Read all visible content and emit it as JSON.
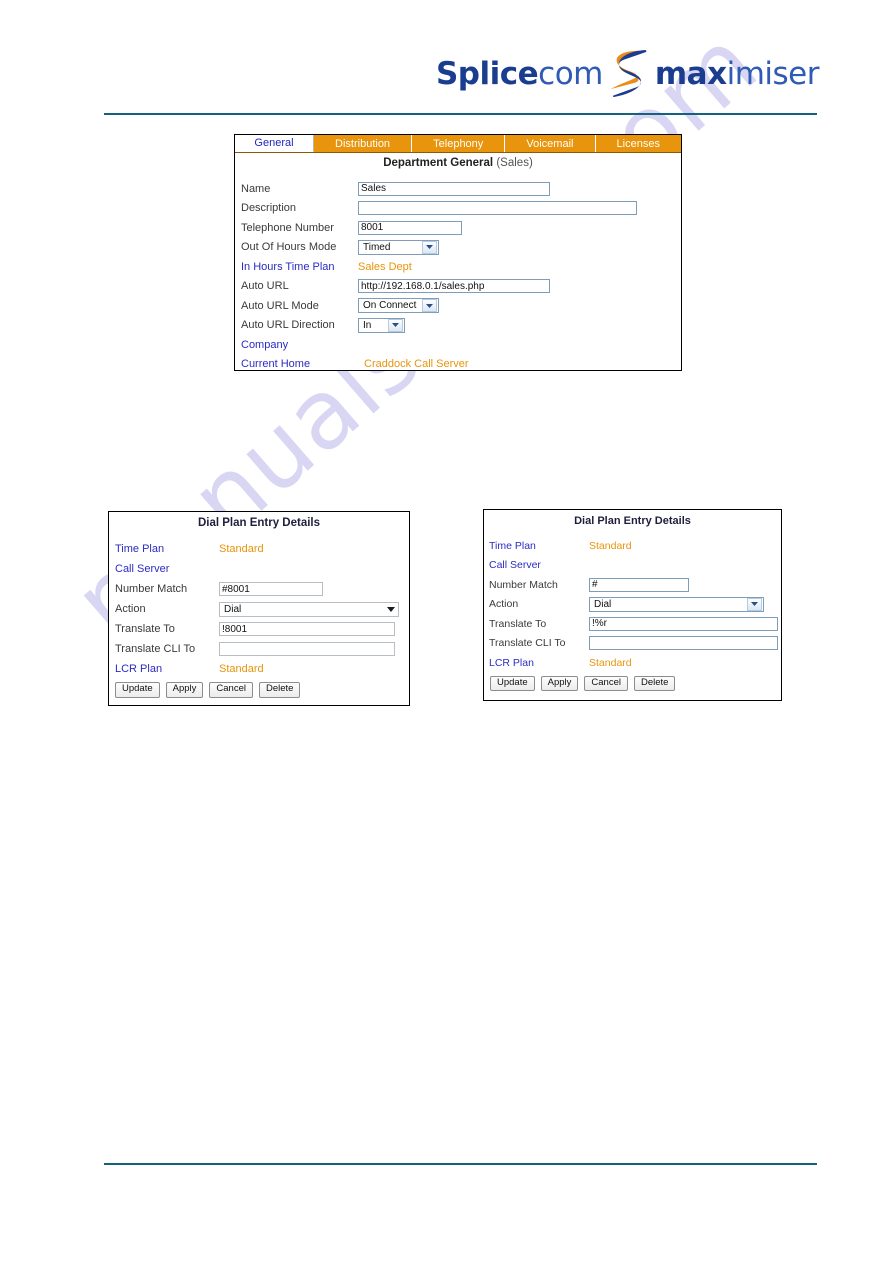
{
  "brand": {
    "name_part1": "Splice",
    "name_part2": "com",
    "name_part3": "max",
    "name_part4": "imiser",
    "swoosh_icon": "s-swoosh-icon",
    "color_dark_blue": "#1b3d8f",
    "color_light_blue": "#2f5ab5",
    "color_orange": "#e8940c"
  },
  "watermark": {
    "text": "manualshive.com"
  },
  "department_panel": {
    "tabs": [
      {
        "label": "General",
        "active": true
      },
      {
        "label": "Distribution",
        "active": false
      },
      {
        "label": "Telephony",
        "active": false
      },
      {
        "label": "Voicemail",
        "active": false
      },
      {
        "label": "Licenses",
        "active": false
      }
    ],
    "title_main": "Department General",
    "title_sub": "(Sales)",
    "fields": {
      "name_label": "Name",
      "name_value": "Sales",
      "description_label": "Description",
      "description_value": "",
      "telephone_number_label": "Telephone Number",
      "telephone_number_value": "8001",
      "out_of_hours_mode_label": "Out Of Hours Mode",
      "out_of_hours_mode_value": "Timed",
      "in_hours_time_plan_label": "In Hours Time Plan",
      "in_hours_time_plan_value": "Sales Dept",
      "auto_url_label": "Auto URL",
      "auto_url_value": "http://192.168.0.1/sales.php",
      "auto_url_mode_label": "Auto URL Mode",
      "auto_url_mode_value": "On Connect",
      "auto_url_direction_label": "Auto URL Direction",
      "auto_url_direction_value": "In",
      "company_label": "Company",
      "company_value": "",
      "current_home_label": "Current Home",
      "current_home_value": "Craddock Call Server"
    }
  },
  "dial_plan_left": {
    "title": "Dial Plan Entry Details",
    "fields": {
      "time_plan_label": "Time Plan",
      "time_plan_value": "Standard",
      "call_server_label": "Call Server",
      "call_server_value": "",
      "number_match_label": "Number Match",
      "number_match_value": "#8001",
      "action_label": "Action",
      "action_value": "Dial",
      "translate_to_label": "Translate To",
      "translate_to_value": "!8001",
      "translate_cli_to_label": "Translate CLI To",
      "translate_cli_to_value": "",
      "lcr_plan_label": "LCR Plan",
      "lcr_plan_value": "Standard"
    },
    "buttons": [
      "Update",
      "Apply",
      "Cancel",
      "Delete"
    ]
  },
  "dial_plan_right": {
    "title": "Dial Plan Entry Details",
    "fields": {
      "time_plan_label": "Time Plan",
      "time_plan_value": "Standard",
      "call_server_label": "Call Server",
      "call_server_value": "",
      "number_match_label": "Number Match",
      "number_match_value": "#",
      "action_label": "Action",
      "action_value": "Dial",
      "translate_to_label": "Translate To",
      "translate_to_value": "!%r",
      "translate_cli_to_label": "Translate CLI To",
      "translate_cli_to_value": "",
      "lcr_plan_label": "LCR Plan",
      "lcr_plan_value": "Standard"
    },
    "buttons": [
      "Update",
      "Apply",
      "Cancel",
      "Delete"
    ]
  }
}
